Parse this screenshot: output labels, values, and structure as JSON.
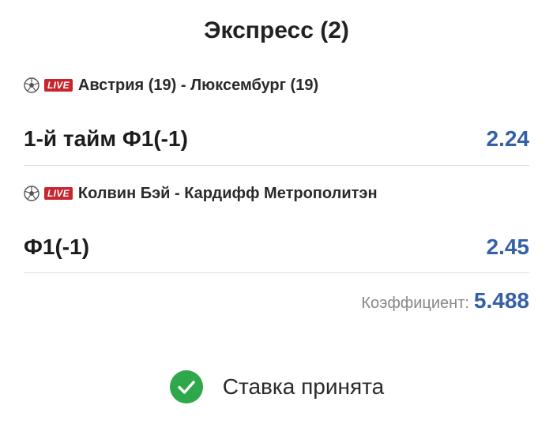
{
  "title": "Экспресс (2)",
  "events": [
    {
      "sport_icon": "soccer-ball-icon",
      "live_label": "LIVE",
      "match": "Австрия (19) - Люксембург (19)",
      "bet": "1-й тайм Ф1(-1)",
      "odd": "2.24"
    },
    {
      "sport_icon": "soccer-ball-icon",
      "live_label": "LIVE",
      "match": "Колвин Бэй - Кардифф Метрополитэн",
      "bet": "Ф1(-1)",
      "odd": "2.45"
    }
  ],
  "total": {
    "label": "Коэффициент:",
    "value": "5.488"
  },
  "status": {
    "icon": "check-circle-icon",
    "text": "Ставка принята"
  },
  "colors": {
    "odd": "#3460a8",
    "live": "#c7262e",
    "success": "#2ea84a"
  }
}
